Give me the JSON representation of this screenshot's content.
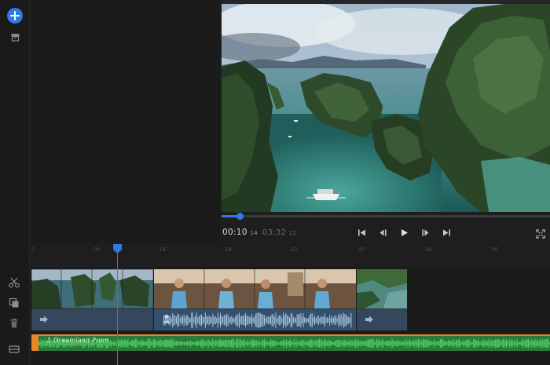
{
  "player": {
    "current_time": "00:10",
    "current_frame": "14",
    "total_time": "03:32",
    "total_frame": "12",
    "progress": 0.057
  },
  "timeline": {
    "ruler_ticks": [
      "0",
      "08",
      "16",
      "24",
      "32",
      "40",
      "48",
      "56"
    ],
    "music_clip_name": "Dreamland Prom"
  },
  "colors": {
    "accent": "#2f7ae5",
    "music_track": "#2b7a3a",
    "music_handle": "#e8862a",
    "clip_audio": "#35475a"
  },
  "icons": {
    "rail": [
      "add-icon",
      "media-library-icon"
    ],
    "timeline_tools": [
      "scissors-icon",
      "duplicate-icon",
      "trash-icon",
      "track-settings-icon"
    ],
    "transport": [
      "skip-back-icon",
      "frame-back-icon",
      "play-icon",
      "frame-forward-icon",
      "skip-forward-icon",
      "fullscreen-icon"
    ]
  }
}
